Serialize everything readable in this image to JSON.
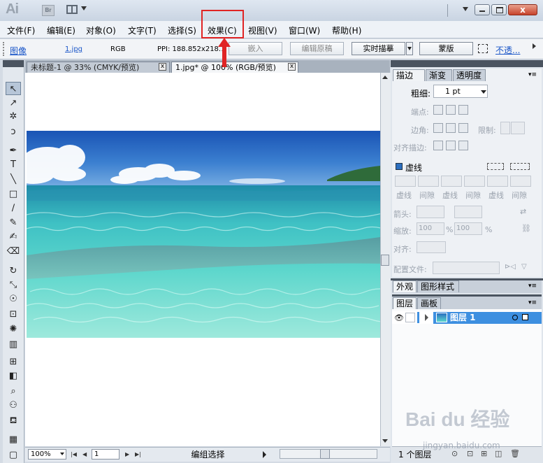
{
  "window": {
    "app_logo": "Ai",
    "bridge_icon_label": "Br",
    "close_glyph": "x"
  },
  "menubar": {
    "items": [
      "文件(F)",
      "编辑(E)",
      "对象(O)",
      "文字(T)",
      "选择(S)",
      "效果(C)",
      "视图(V)",
      "窗口(W)",
      "帮助(H)"
    ],
    "highlighted": "效果(C)"
  },
  "controlbar": {
    "object_type": "图像",
    "file_name": "1.jpg",
    "color_mode": "RGB",
    "ppi": "PPI: 188.852x218.182",
    "embed_button": "嵌入",
    "edit_original_button": "编辑原稿",
    "live_trace_button": "实时描摹",
    "mask_button": "蒙版",
    "opacity_label": "不透..."
  },
  "document": {
    "tabs": [
      {
        "label": "未标题-1 @ 33% (CMYK/预览)",
        "active": false
      },
      {
        "label": "1.jpg* @ 100% (RGB/预览)",
        "active": true
      }
    ],
    "close_glyph": "x"
  },
  "statusbar": {
    "zoom": "100%",
    "artboard": "1",
    "status": "编组选择",
    "nav_first": "|◀",
    "nav_prev": "◀",
    "nav_next": "▶",
    "nav_last": "▶|"
  },
  "stroke_panel": {
    "tabs": [
      "描边",
      "渐变",
      "透明度"
    ],
    "weight_label": "粗细:",
    "weight_value": "1 pt",
    "cap_label": "端点:",
    "corner_label": "边角:",
    "limit_label": "限制:",
    "align_label": "对齐描边:",
    "dashed_label": "虚线",
    "dash_fields": [
      "虚线",
      "间隙",
      "虚线",
      "间隙",
      "虚线",
      "间隙"
    ],
    "arrow_label": "箭头:",
    "scale_label": "缩放:",
    "scale_start": "100",
    "scale_end": "100",
    "percent": "%",
    "align_arrow_label": "对齐:",
    "profile_label": "配置文件:"
  },
  "appearance_panel": {
    "tabs": [
      "外观",
      "图形样式"
    ]
  },
  "layers_panel": {
    "tabs": [
      "图层",
      "画板"
    ],
    "layer_name": "图层 1",
    "footer_count": "1 个图层"
  },
  "tools": [
    {
      "name": "selection-tool-icon",
      "glyph": "↖"
    },
    {
      "name": "direct-selection-tool-icon",
      "glyph": "↗"
    },
    {
      "name": "magic-wand-tool-icon",
      "glyph": "✲"
    },
    {
      "name": "lasso-tool-icon",
      "glyph": "ↄ"
    },
    {
      "name": "pen-tool-icon",
      "glyph": "✒"
    },
    {
      "name": "type-tool-icon",
      "glyph": "T"
    },
    {
      "name": "line-tool-icon",
      "glyph": "╲"
    },
    {
      "name": "rectangle-tool-icon",
      "glyph": "□"
    },
    {
      "name": "paintbrush-tool-icon",
      "glyph": "∕"
    },
    {
      "name": "pencil-tool-icon",
      "glyph": "✎"
    },
    {
      "name": "blob-brush-tool-icon",
      "glyph": "✍"
    },
    {
      "name": "eraser-tool-icon",
      "glyph": "⌫"
    },
    {
      "name": "rotate-tool-icon",
      "glyph": "↻"
    },
    {
      "name": "scale-tool-icon",
      "glyph": "⤡"
    },
    {
      "name": "warp-tool-icon",
      "glyph": "☉"
    },
    {
      "name": "free-transform-tool-icon",
      "glyph": "⊡"
    },
    {
      "name": "symbol-sprayer-tool-icon",
      "glyph": "✺"
    },
    {
      "name": "graph-tool-icon",
      "glyph": "▥"
    },
    {
      "name": "mesh-tool-icon",
      "glyph": "⊞"
    },
    {
      "name": "gradient-tool-icon",
      "glyph": "◧"
    },
    {
      "name": "eyedropper-tool-icon",
      "glyph": "⌕"
    },
    {
      "name": "blend-tool-icon",
      "glyph": "⚇"
    },
    {
      "name": "live-paint-bucket-tool-icon",
      "glyph": "⛾"
    },
    {
      "name": "column-graph-icon",
      "glyph": "▦"
    },
    {
      "name": "artboard-tool-icon",
      "glyph": "▢"
    }
  ],
  "watermark": {
    "text": "Bai du 经验",
    "sub": "jingyan.baidu.com"
  },
  "colors": {
    "highlight_red": "#e02424",
    "layer_selected": "#3d8fe0",
    "panel_bg": "#eef1f5"
  }
}
